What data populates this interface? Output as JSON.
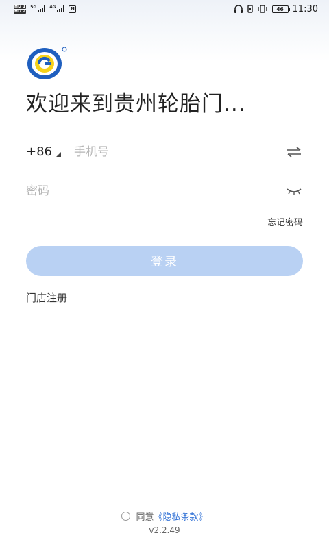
{
  "status_bar": {
    "hd1": "HD 1",
    "hd2": "HD 2",
    "net1": "5G",
    "net2": "4G",
    "battery": "46",
    "time": "11:30"
  },
  "app": {
    "welcome_title": "欢迎来到贵州轮胎门..."
  },
  "form": {
    "country_code": "+86",
    "phone_placeholder": "手机号",
    "password_placeholder": "密码",
    "forgot_password": "忘记密码",
    "login_button": "登录",
    "register_link": "门店注册"
  },
  "footer": {
    "agree_text": "同意",
    "policy_link": "《隐私条款》",
    "version": "v2.2.49"
  },
  "icons": {
    "logo": "gtc-logo-icon",
    "switch": "switch-login-icon",
    "eye": "eye-closed-icon"
  },
  "colors": {
    "accent": "#b9d1f3",
    "link": "#3b78d8",
    "logo_blue": "#1f5fbf",
    "logo_yellow": "#f5d11a"
  }
}
